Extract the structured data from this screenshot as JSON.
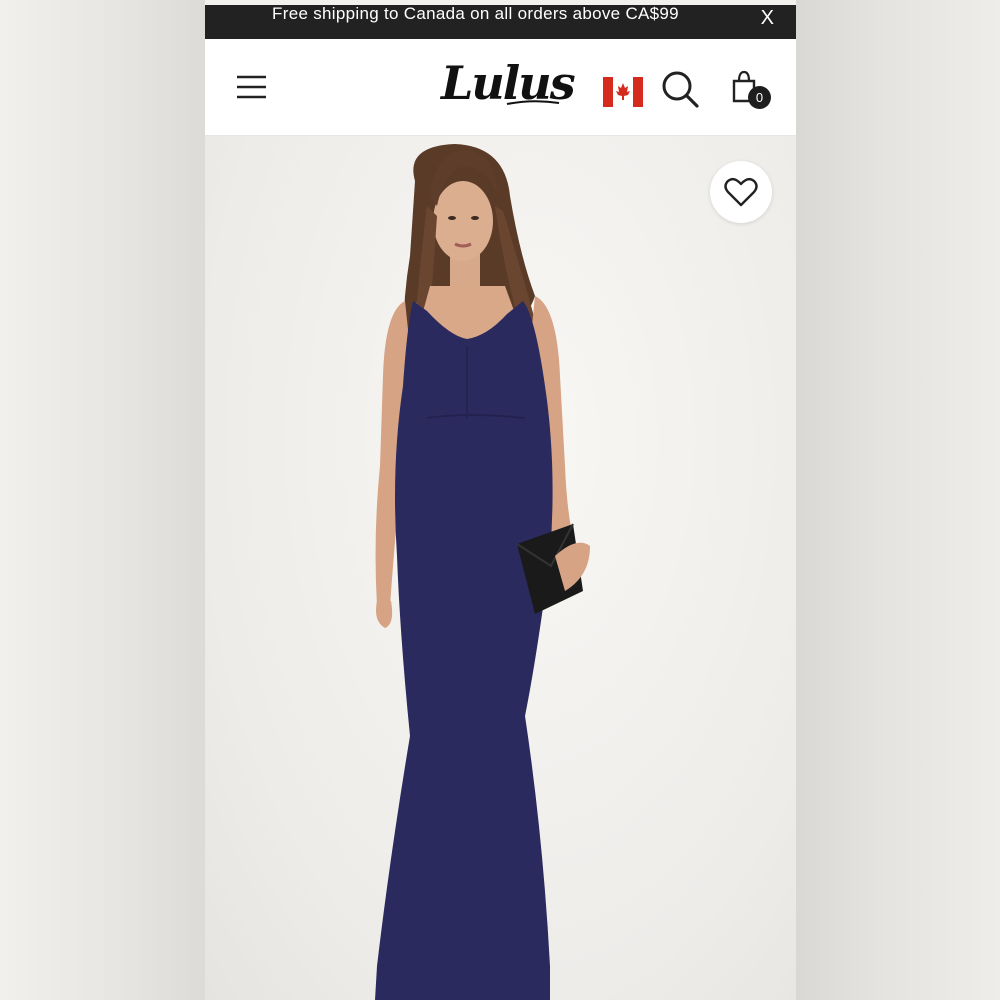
{
  "promo": {
    "text": "Free shipping to Canada on all orders above CA$99",
    "close_label": "X"
  },
  "header": {
    "logo_text": "Lulus",
    "cart_count": "0"
  },
  "icons": {
    "menu": "hamburger-menu-icon",
    "flag": "canada-flag-icon",
    "search": "search-icon",
    "bag": "shopping-bag-icon",
    "wishlist": "heart-icon"
  },
  "colors": {
    "promo_bar": "#222222",
    "dress": "#2b2a5e",
    "flag_red": "#d52b1e"
  }
}
